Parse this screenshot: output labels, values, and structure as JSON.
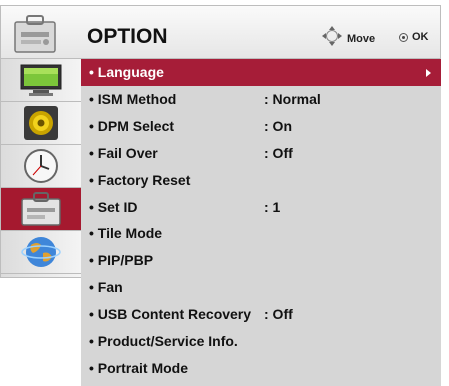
{
  "header": {
    "title": "OPTION",
    "move_label": "Move",
    "ok_label": "OK"
  },
  "categories": [
    {
      "name": "picture",
      "icon": "monitor-icon",
      "active": false
    },
    {
      "name": "audio",
      "icon": "speaker-icon",
      "active": false
    },
    {
      "name": "time",
      "icon": "clock-icon",
      "active": false
    },
    {
      "name": "option",
      "icon": "toolbox-icon",
      "active": true
    },
    {
      "name": "network",
      "icon": "globe-icon",
      "active": false
    }
  ],
  "items": [
    {
      "label": "• Language",
      "value": "",
      "selected": true
    },
    {
      "label": "• ISM Method",
      "value": ": Normal"
    },
    {
      "label": "• DPM Select",
      "value": ": On"
    },
    {
      "label": "• Fail Over",
      "value": ": Off"
    },
    {
      "label": "• Factory Reset",
      "value": ""
    },
    {
      "label": "• Set ID",
      "value": ": 1"
    },
    {
      "label": "• Tile Mode",
      "value": ""
    },
    {
      "label": "• PIP/PBP",
      "value": ""
    },
    {
      "label": "• Fan",
      "value": ""
    },
    {
      "label": "• USB Content Recovery",
      "value": ": Off"
    },
    {
      "label": "• Product/Service Info.",
      "value": ""
    },
    {
      "label": "• Portrait Mode",
      "value": ""
    }
  ],
  "colors": {
    "selected": "#a61d38",
    "panel": "#d6d6d6"
  }
}
